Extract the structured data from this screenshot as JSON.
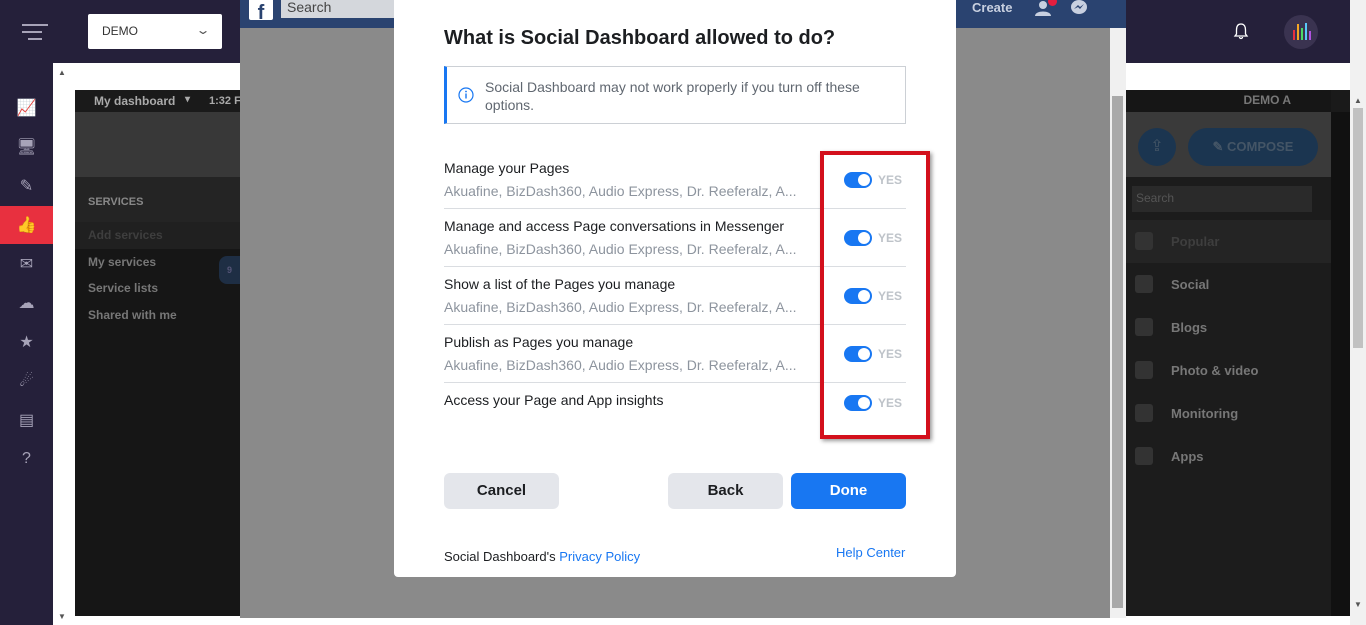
{
  "app": {
    "org_select_value": "DEMO",
    "colors": {
      "topbar": "#25203a",
      "accent": "#e8303f"
    }
  },
  "rail": {
    "items": [
      {
        "name": "analytics-icon",
        "glyph": "📈"
      },
      {
        "name": "monitor-icon",
        "glyph": "🖥"
      },
      {
        "name": "pencil-icon",
        "glyph": "✎"
      },
      {
        "name": "thumbs-up-icon",
        "glyph": "👍",
        "active": true
      },
      {
        "name": "inbox-icon",
        "glyph": "✉"
      },
      {
        "name": "cloud-icon",
        "glyph": "☁"
      },
      {
        "name": "star-icon",
        "glyph": "★"
      },
      {
        "name": "rocket-icon",
        "glyph": "☄"
      },
      {
        "name": "calendar-icon",
        "glyph": "▤"
      },
      {
        "name": "help-icon",
        "glyph": "?"
      }
    ]
  },
  "embed": {
    "dashboard_label": "My dashboard",
    "time_label": "1:32 F",
    "user_label": "DEMO A",
    "services_header": "SERVICES",
    "services": [
      {
        "label": "Add services",
        "dim": true
      },
      {
        "label": "My services",
        "count": "9"
      },
      {
        "label": "Service lists"
      },
      {
        "label": "Shared with me"
      }
    ],
    "compose_label": "COMPOSE",
    "search_placeholder": "Search",
    "categories": [
      "Popular",
      "Social",
      "Blogs",
      "Photo & video",
      "Monitoring",
      "Apps"
    ]
  },
  "facebook": {
    "search_placeholder": "Search",
    "create_label": "Create"
  },
  "dialog": {
    "title": "What is Social Dashboard allowed to do?",
    "notice": "Social Dashboard may not work properly if you turn off these options.",
    "permissions": [
      {
        "title": "Manage your Pages",
        "pages": "Akuafine, BizDash360, Audio Express, Dr. Reeferalz, A...",
        "value": "YES"
      },
      {
        "title": "Manage and access Page conversations in Messenger",
        "pages": "Akuafine, BizDash360, Audio Express, Dr. Reeferalz, A...",
        "value": "YES"
      },
      {
        "title": "Show a list of the Pages you manage",
        "pages": "Akuafine, BizDash360, Audio Express, Dr. Reeferalz, A...",
        "value": "YES"
      },
      {
        "title": "Publish as Pages you manage",
        "pages": "Akuafine, BizDash360, Audio Express, Dr. Reeferalz, A...",
        "value": "YES"
      },
      {
        "title": "Access your Page and App insights",
        "pages": "",
        "value": "YES"
      }
    ],
    "cancel_label": "Cancel",
    "back_label": "Back",
    "done_label": "Done",
    "footer_prefix": "Social Dashboard's",
    "privacy_label": "Privacy Policy",
    "help_label": "Help Center"
  }
}
